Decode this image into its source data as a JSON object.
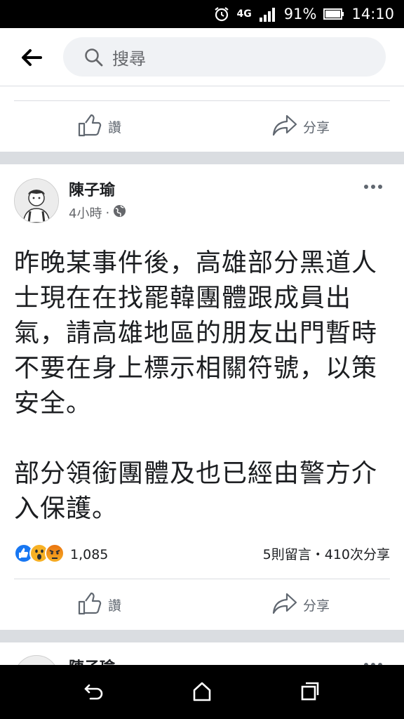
{
  "status_bar": {
    "network": "4G",
    "battery": "91%",
    "time": "14:10",
    "icons": [
      "alarm-icon",
      "signal-icon",
      "battery-icon"
    ]
  },
  "top_bar": {
    "back_icon": "back-arrow-icon",
    "search_placeholder": "搜尋",
    "search_icon": "search-icon"
  },
  "prev_post": {
    "like_label": "讚",
    "share_label": "分享"
  },
  "post": {
    "author": "陳子瑜",
    "time": "4小時",
    "separator": "·",
    "privacy_icon": "globe-icon",
    "more_icon": "more-dots-icon",
    "paragraphs": [
      "昨晚某事件後，高雄部分黑道人士現在在找罷韓團體跟成員出氣，請高雄地區的朋友出門暫時不要在身上標示相關符號，以策安全。",
      "部分領銜團體及也已經由警方介入保護。"
    ],
    "reaction_icons": [
      "like-reaction-icon",
      "wow-reaction-icon",
      "angry-reaction-icon"
    ],
    "reaction_count": "1,085",
    "stats": "5則留言・410次分享",
    "like_label": "讚",
    "share_label": "分享"
  },
  "next_post": {
    "author": "陳子瑜"
  },
  "nav_bar": {
    "icons": [
      "back-nav-icon",
      "home-nav-icon",
      "recents-nav-icon"
    ]
  },
  "colors": {
    "accent": "#1877f2",
    "secondary_text": "#65676b",
    "divider": "#dadde1"
  }
}
